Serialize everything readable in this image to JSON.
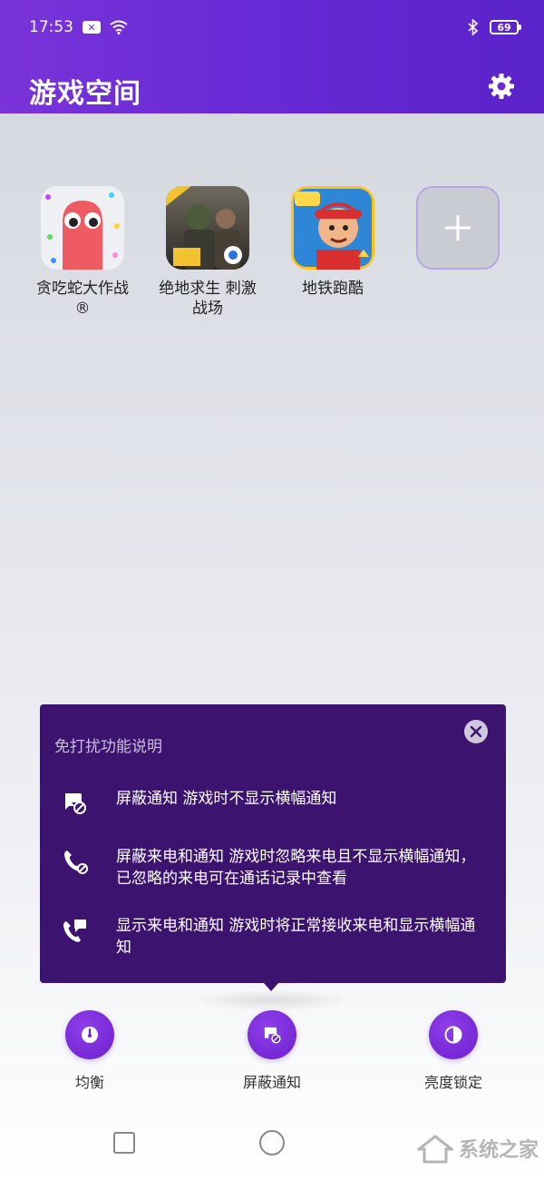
{
  "status_bar": {
    "time": "17:53",
    "battery": "69"
  },
  "header": {
    "title": "游戏空间"
  },
  "games": [
    {
      "name": "贪吃蛇大作战®"
    },
    {
      "name": "绝地求生 刺激战场"
    },
    {
      "name": "地铁跑酷"
    }
  ],
  "popup": {
    "title": "免打扰功能说明",
    "options": [
      {
        "text": "屏蔽通知 游戏时不显示横幅通知"
      },
      {
        "text": "屏蔽来电和通知 游戏时忽略来电且不显示横幅通知，已忽略的来电可在通话记录中查看"
      },
      {
        "text": "显示来电和通知 游戏时将正常接收来电和显示横幅通知"
      }
    ]
  },
  "tools": [
    {
      "label": "均衡"
    },
    {
      "label": "屏蔽通知"
    },
    {
      "label": "亮度锁定"
    }
  ],
  "watermark": {
    "text": "系统之家"
  },
  "colors": {
    "accent": "#6a2bd6",
    "popup_bg": "#3c1470"
  }
}
